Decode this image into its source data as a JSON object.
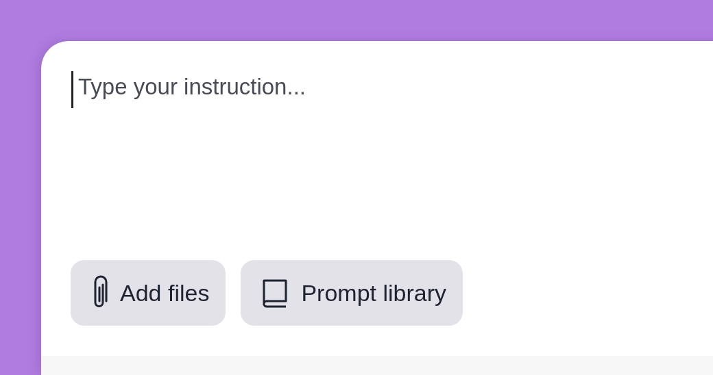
{
  "composer": {
    "placeholder": "Type your instruction...",
    "buttons": [
      {
        "label": "Add files",
        "kind": "attach"
      },
      {
        "label": "Prompt library",
        "kind": "library"
      }
    ]
  }
}
